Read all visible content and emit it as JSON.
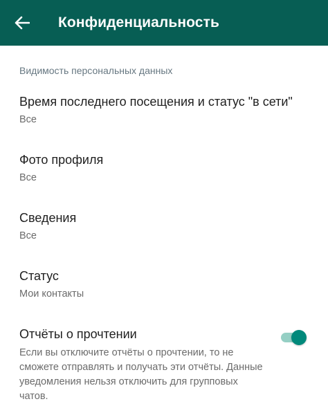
{
  "appbar": {
    "title": "Конфиденциальность",
    "back_icon": "arrow-back-icon",
    "background": "#075e54"
  },
  "section": {
    "header": "Видимость персональных данных"
  },
  "items": [
    {
      "title": "Время последнего посещения и статус \"в сети\"",
      "value": "Все"
    },
    {
      "title": "Фото профиля",
      "value": "Все"
    },
    {
      "title": "Сведения",
      "value": "Все"
    },
    {
      "title": "Статус",
      "value": "Мои контакты"
    }
  ],
  "read_receipts": {
    "title": "Отчёты о прочтении",
    "description": "Если вы отключите отчёты о прочтении, то не сможете отправлять и получать эти отчёты. Данные уведомления нельзя отключить для групповых чатов.",
    "enabled": true,
    "accent": "#00897b"
  }
}
